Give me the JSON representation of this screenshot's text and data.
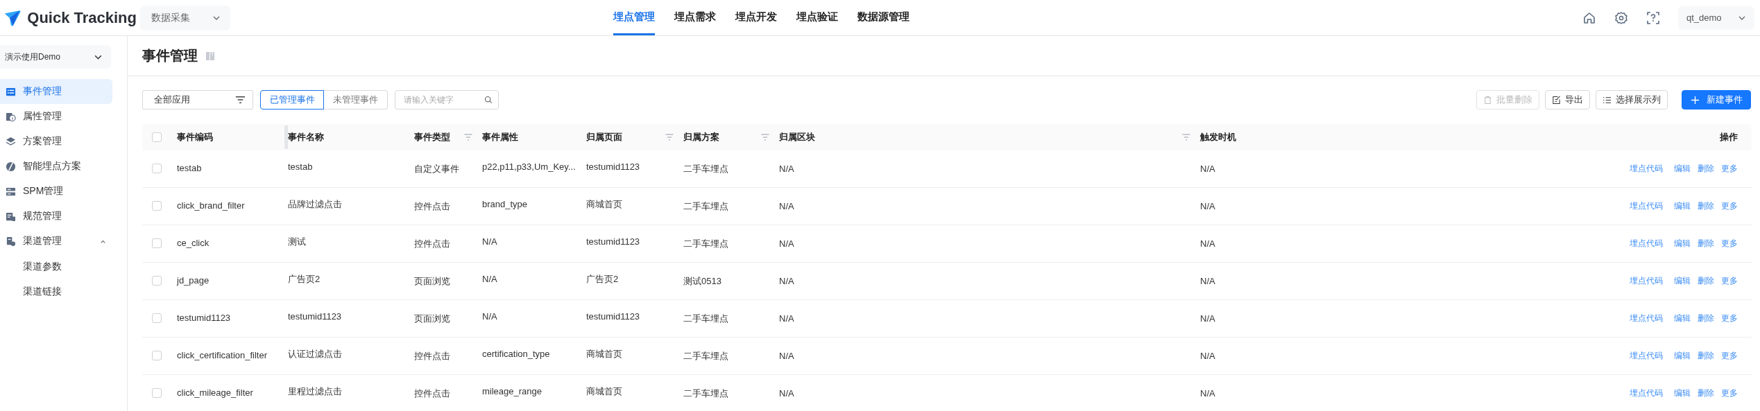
{
  "app": {
    "name": "Quick Tracking"
  },
  "module_selector": {
    "value": "数据采集"
  },
  "nav": [
    {
      "label": "埋点管理",
      "selected": true
    },
    {
      "label": "埋点需求",
      "selected": false
    },
    {
      "label": "埋点开发",
      "selected": false
    },
    {
      "label": "埋点验证",
      "selected": false
    },
    {
      "label": "数据源管理",
      "selected": false
    }
  ],
  "user": {
    "name": "qt_demo"
  },
  "sidebar": {
    "project": "演示使用Demo",
    "items": [
      {
        "label": "事件管理",
        "selected": true
      },
      {
        "label": "属性管理",
        "selected": false
      },
      {
        "label": "方案管理",
        "selected": false
      },
      {
        "label": "智能埋点方案",
        "selected": false
      },
      {
        "label": "SPM管理",
        "selected": false
      },
      {
        "label": "规范管理",
        "selected": false
      },
      {
        "label": "渠道管理",
        "selected": false,
        "expanded": true,
        "children": [
          {
            "label": "渠道参数",
            "selected": false
          },
          {
            "label": "渠道链接",
            "selected": false
          }
        ]
      }
    ]
  },
  "page": {
    "title": "事件管理"
  },
  "toolbar": {
    "app_filter": "全部应用",
    "segments": [
      {
        "label": "已管理事件",
        "selected": true
      },
      {
        "label": "未管理事件",
        "selected": false
      }
    ],
    "search": {
      "placeholder": "请输入关键字"
    },
    "buttons": [
      {
        "label": "批量删除",
        "kind": "batch-delete",
        "disabled": true
      },
      {
        "label": "导出",
        "kind": "export",
        "disabled": false
      },
      {
        "label": "选择展示列",
        "kind": "columns",
        "disabled": false
      },
      {
        "label": "新建事件",
        "kind": "create",
        "disabled": false
      }
    ]
  },
  "table": {
    "select_all_checked": false,
    "columns": [
      {
        "label": "事件编码",
        "filterable": false
      },
      {
        "label": "事件名称",
        "filterable": false
      },
      {
        "label": "事件类型",
        "filterable": true
      },
      {
        "label": "事件属性",
        "filterable": false
      },
      {
        "label": "归属页面",
        "filterable": true
      },
      {
        "label": "归属方案",
        "filterable": true
      },
      {
        "label": "归属区块",
        "filterable": true
      },
      {
        "label": "触发时机",
        "filterable": false
      },
      {
        "label": "操作",
        "filterable": false
      }
    ],
    "rows": [
      {
        "checked": false,
        "cells": [
          "testab",
          "testab",
          "自定义事件",
          "p22,p11,p33,Um_Key...",
          "testumid1123",
          "二手车埋点",
          "N/A",
          "N/A"
        ],
        "actions": [
          "埋点代码",
          "编辑",
          "删除",
          "更多"
        ]
      },
      {
        "checked": false,
        "cells": [
          "click_brand_filter",
          "品牌过滤点击",
          "控件点击",
          "brand_type",
          "商城首页",
          "二手车埋点",
          "N/A",
          "N/A"
        ],
        "actions": [
          "埋点代码",
          "编辑",
          "删除",
          "更多"
        ]
      },
      {
        "checked": false,
        "cells": [
          "ce_click",
          "测试",
          "控件点击",
          "N/A",
          "testumid1123",
          "二手车埋点",
          "N/A",
          "N/A"
        ],
        "actions": [
          "埋点代码",
          "编辑",
          "删除",
          "更多"
        ]
      },
      {
        "checked": false,
        "cells": [
          "jd_page",
          "广告页2",
          "页面浏览",
          "N/A",
          "广告页2",
          "测试0513",
          "N/A",
          "N/A"
        ],
        "actions": [
          "埋点代码",
          "编辑",
          "删除",
          "更多"
        ]
      },
      {
        "checked": false,
        "cells": [
          "testumid1123",
          "testumid1123",
          "页面浏览",
          "N/A",
          "testumid1123",
          "二手车埋点",
          "N/A",
          "N/A"
        ],
        "actions": [
          "埋点代码",
          "编辑",
          "删除",
          "更多"
        ]
      },
      {
        "checked": false,
        "cells": [
          "click_certification_filter",
          "认证过滤点击",
          "控件点击",
          "certification_type",
          "商城首页",
          "二手车埋点",
          "N/A",
          "N/A"
        ],
        "actions": [
          "埋点代码",
          "编辑",
          "删除",
          "更多"
        ]
      },
      {
        "checked": false,
        "cells": [
          "click_mileage_filter",
          "里程过滤点击",
          "控件点击",
          "mileage_range",
          "商城首页",
          "二手车埋点",
          "N/A",
          "N/A"
        ],
        "actions": [
          "埋点代码",
          "编辑",
          "删除",
          "更多"
        ]
      }
    ]
  }
}
